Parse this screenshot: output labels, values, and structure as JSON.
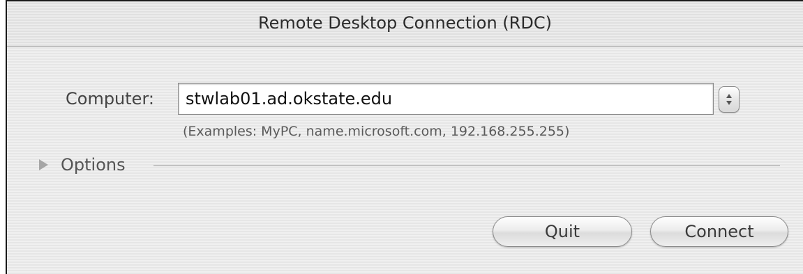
{
  "window": {
    "title": "Remote Desktop Connection (RDC)"
  },
  "form": {
    "computer_label": "Computer:",
    "computer_value": "stwlab01.ad.okstate.edu",
    "examples_hint": "(Examples: MyPC, name.microsoft.com, 192.168.255.255)"
  },
  "options": {
    "label": "Options",
    "expanded": false
  },
  "buttons": {
    "quit_label": "Quit",
    "connect_label": "Connect"
  },
  "icons": {
    "stepper": "up-down-stepper-icon",
    "disclosure": "disclosure-triangle-right-icon"
  }
}
